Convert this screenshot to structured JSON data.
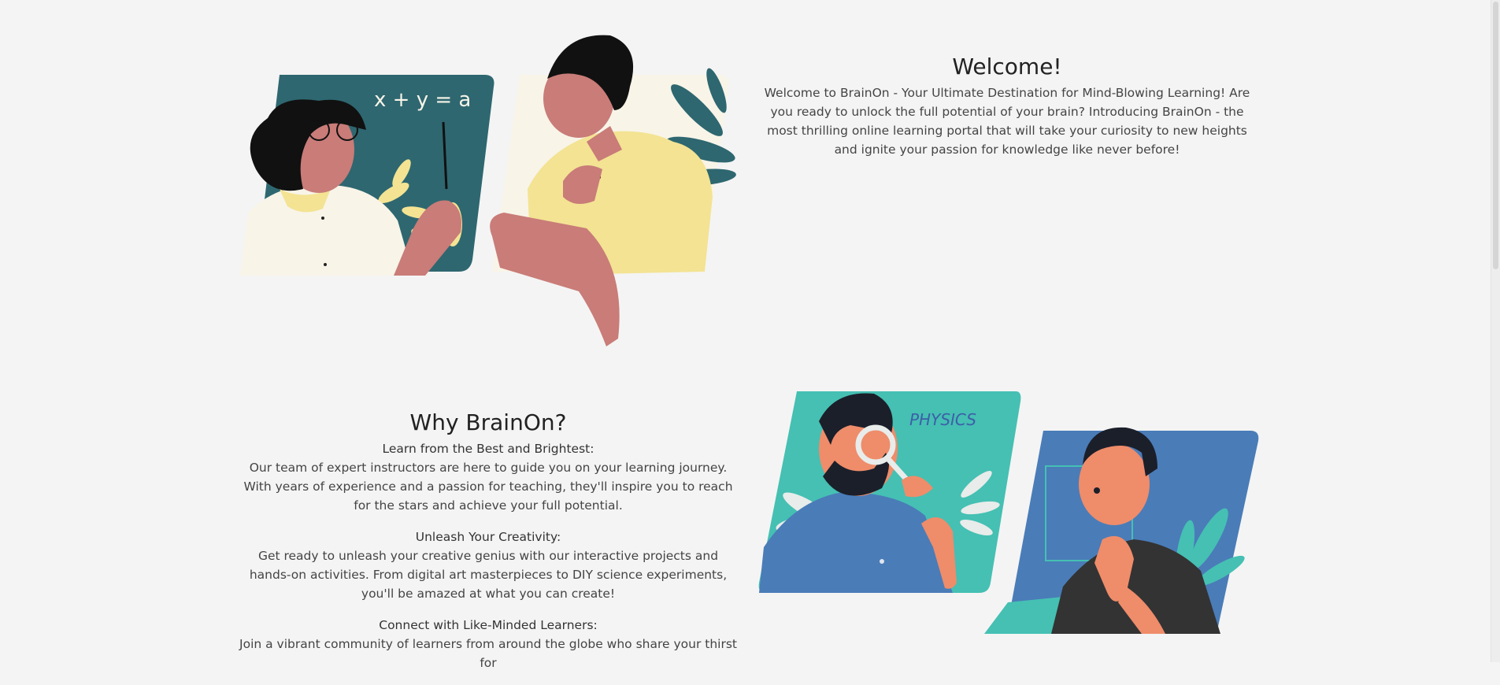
{
  "welcome": {
    "title": "Welcome!",
    "body": "Welcome to BrainOn - Your Ultimate Destination for Mind-Blowing Learning! Are you ready to unlock the full potential of your brain? Introducing BrainOn - the most thrilling online learning portal that will take your curiosity to new heights and ignite your passion for knowledge like never before!"
  },
  "why": {
    "title": "Why BrainOn?",
    "features": [
      {
        "heading": "Learn from the Best and Brightest:",
        "body": "Our team of expert instructors are here to guide you on your learning journey. With years of experience and a passion for teaching, they'll inspire you to reach for the stars and achieve your full potential."
      },
      {
        "heading": "Unleash Your Creativity:",
        "body": "Get ready to unleash your creative genius with our interactive projects and hands-on activities. From digital art masterpieces to DIY science experiments, you'll be amazed at what you can create!"
      },
      {
        "heading": "Connect with Like-Minded Learners:",
        "body": "Join a vibrant community of learners from around the globe who share your thirst for"
      }
    ]
  },
  "illustrations": {
    "top_equation": "x + y = a",
    "bottom_label": "PHYSICS"
  },
  "colors": {
    "teal_dark": "#2e6770",
    "cream": "#f8f4e8",
    "yellow": "#f3e393",
    "skin_pink": "#c97c78",
    "teal_light": "#45c0b3",
    "blue": "#4a7cb8",
    "skin_orange": "#ef8c6a",
    "dark": "#1b1f2a"
  }
}
